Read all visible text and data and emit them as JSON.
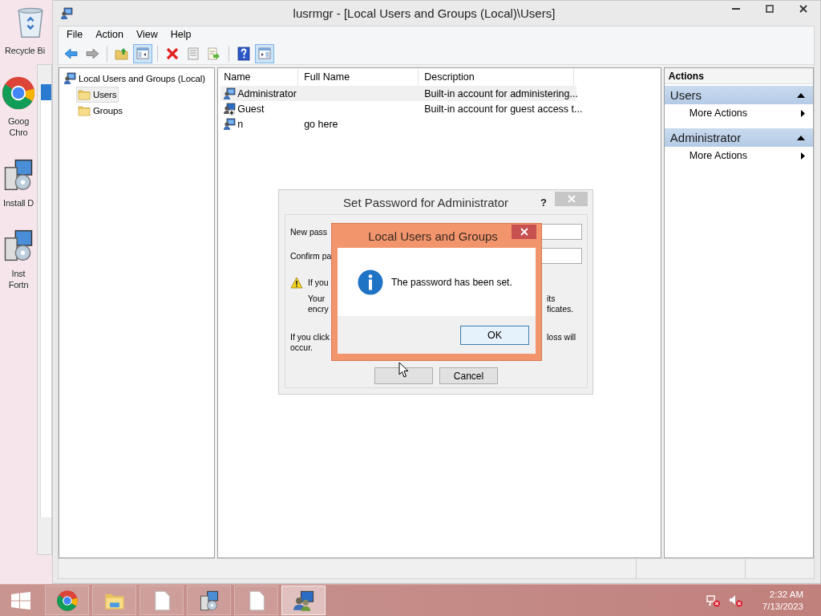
{
  "desktop_icons": [
    {
      "kind": "recycle-bin",
      "lines": [
        "Recycle Bi"
      ]
    },
    {
      "kind": "chrome",
      "lines": [
        "Goog",
        "Chro"
      ]
    },
    {
      "kind": "installer",
      "lines": [
        "Install D"
      ]
    },
    {
      "kind": "installer",
      "lines": [
        "Inst",
        "Fortn"
      ]
    }
  ],
  "window": {
    "title": "lusrmgr - [Local Users and Groups (Local)\\Users]",
    "menu": [
      "File",
      "Action",
      "View",
      "Help"
    ],
    "toolbar": [
      {
        "kind": "back",
        "pressed": false
      },
      {
        "kind": "forward",
        "pressed": false
      },
      {
        "kind": "separator"
      },
      {
        "kind": "up-folder",
        "pressed": false
      },
      {
        "kind": "tree-pane",
        "pressed": true
      },
      {
        "kind": "separator"
      },
      {
        "kind": "delete",
        "pressed": false
      },
      {
        "kind": "properties",
        "pressed": false
      },
      {
        "kind": "export",
        "pressed": false
      },
      {
        "kind": "separator"
      },
      {
        "kind": "help",
        "pressed": false
      },
      {
        "kind": "action-pane",
        "pressed": true
      }
    ],
    "tree": [
      {
        "label": "Local Users and Groups (Local)",
        "kind": "computer",
        "selected": false,
        "children": [
          {
            "label": "Users",
            "kind": "folder",
            "selected": true
          },
          {
            "label": "Groups",
            "kind": "folder",
            "selected": false
          }
        ]
      }
    ],
    "list": {
      "columns": [
        "Name",
        "Full Name",
        "Description"
      ],
      "rows": [
        {
          "kind": "user",
          "selected": true,
          "cells": [
            "Administrator",
            "",
            "Built-in account for administering..."
          ]
        },
        {
          "kind": "guest",
          "selected": false,
          "cells": [
            "Guest",
            "",
            "Built-in account for guest access t..."
          ]
        },
        {
          "kind": "user",
          "selected": false,
          "cells": [
            "n",
            "go here",
            ""
          ]
        }
      ]
    },
    "actions": {
      "title": "Actions",
      "sections": [
        {
          "title": "Users",
          "expanded": true,
          "items": [
            "More Actions"
          ]
        },
        {
          "title": "Administrator",
          "expanded": true,
          "items": [
            "More Actions"
          ]
        }
      ]
    }
  },
  "password_dialog": {
    "title": "Set Password for Administrator",
    "help": "?",
    "new_label": "New pass",
    "confirm_label": "Confirm pa",
    "warning": "If you",
    "lines": [
      {
        "left": "Your",
        "right": "its"
      },
      {
        "left": "encry",
        "right": "ficates."
      }
    ],
    "click_line": {
      "left": "If you click",
      "right": "loss will"
    },
    "occur": "occur.",
    "cancel": "Cancel"
  },
  "message_box": {
    "title": "Local Users and Groups",
    "message": "The password has been set.",
    "ok": "OK"
  },
  "taskbar": {
    "apps": [
      {
        "kind": "chrome",
        "active": false
      },
      {
        "kind": "explorer",
        "active": false
      },
      {
        "kind": "document",
        "active": false
      },
      {
        "kind": "installer",
        "active": false
      },
      {
        "kind": "document",
        "active": false
      },
      {
        "kind": "users",
        "active": true
      }
    ],
    "time": "2:32 AM",
    "date": "7/13/2023"
  }
}
